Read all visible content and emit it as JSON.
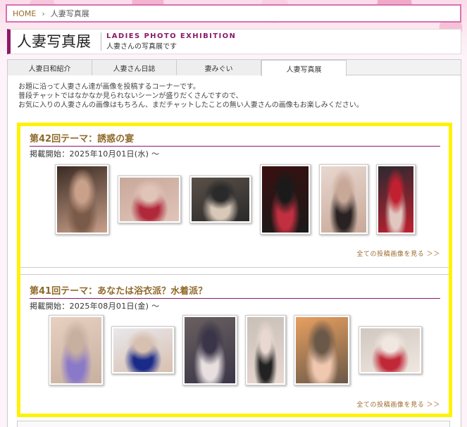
{
  "breadcrumb": {
    "home": "HOME",
    "separator": "›",
    "current": "人妻写真展"
  },
  "header": {
    "title": "人妻写真展",
    "subtitle_en": "LADIES PHOTO EXHIBITION",
    "subtitle_jp": "人妻さんの写真展です"
  },
  "tabs": [
    {
      "label": "人妻日和紹介",
      "active": false
    },
    {
      "label": "人妻さん日誌",
      "active": false
    },
    {
      "label": "妻みぐい",
      "active": false
    },
    {
      "label": "人妻写真展",
      "active": true
    }
  ],
  "intro": [
    "お題に沿って人妻さん達が画像を投稿するコーナーです。",
    "普段チャットではなかなか見られないシーンが盛りだくさんですので、",
    "お気に入りの人妻さんの画像はもちろん、まだチャットしたことの無い人妻さんの画像もお楽しみください。"
  ],
  "themes": [
    {
      "title": "第42回テーマ：誘惑の宴",
      "date": "掲載開始：2025年10月01日(水) ～",
      "see_all": "全ての投稿画像を見る ＞＞",
      "photos": [
        {
          "name": "photo-1",
          "colors": [
            "#3a2a22",
            "#7a5a48",
            "#c9a08a"
          ]
        },
        {
          "name": "photo-2",
          "colors": [
            "#c8a89a",
            "#b0283a",
            "#e0c4b8"
          ]
        },
        {
          "name": "photo-3",
          "colors": [
            "#5a5048",
            "#d8c8b8",
            "#2a2a2a"
          ]
        },
        {
          "name": "photo-4",
          "colors": [
            "#3a1010",
            "#c03040",
            "#1a1a1a"
          ]
        },
        {
          "name": "photo-5",
          "colors": [
            "#e8d8d0",
            "#2a2222",
            "#c8a898"
          ]
        },
        {
          "name": "photo-6",
          "colors": [
            "#2a2a30",
            "#e0c8c0",
            "#c02030"
          ]
        }
      ]
    },
    {
      "title": "第41回テーマ：あなたは浴衣派？水着派？",
      "date": "掲載開始：2025年08月01日(金) ～",
      "see_all": "全ての投稿画像を見る ＞＞",
      "photos": [
        {
          "name": "photo-7",
          "colors": [
            "#e8d0c0",
            "#8a78c8",
            "#c8b0a0"
          ]
        },
        {
          "name": "photo-8",
          "colors": [
            "#e8e8ec",
            "#1a2a88",
            "#d8c0b0"
          ]
        },
        {
          "name": "photo-9",
          "colors": [
            "#6a6060",
            "#e8e0e0",
            "#3a3548"
          ]
        },
        {
          "name": "photo-10",
          "colors": [
            "#c8c0b8",
            "#222222",
            "#e8d8d0"
          ]
        },
        {
          "name": "photo-11",
          "colors": [
            "#e8a060",
            "#f0c8b0",
            "#6a5848"
          ]
        },
        {
          "name": "photo-12",
          "colors": [
            "#d0c8c0",
            "#c02838",
            "#f0e8e0"
          ]
        }
      ]
    }
  ]
}
